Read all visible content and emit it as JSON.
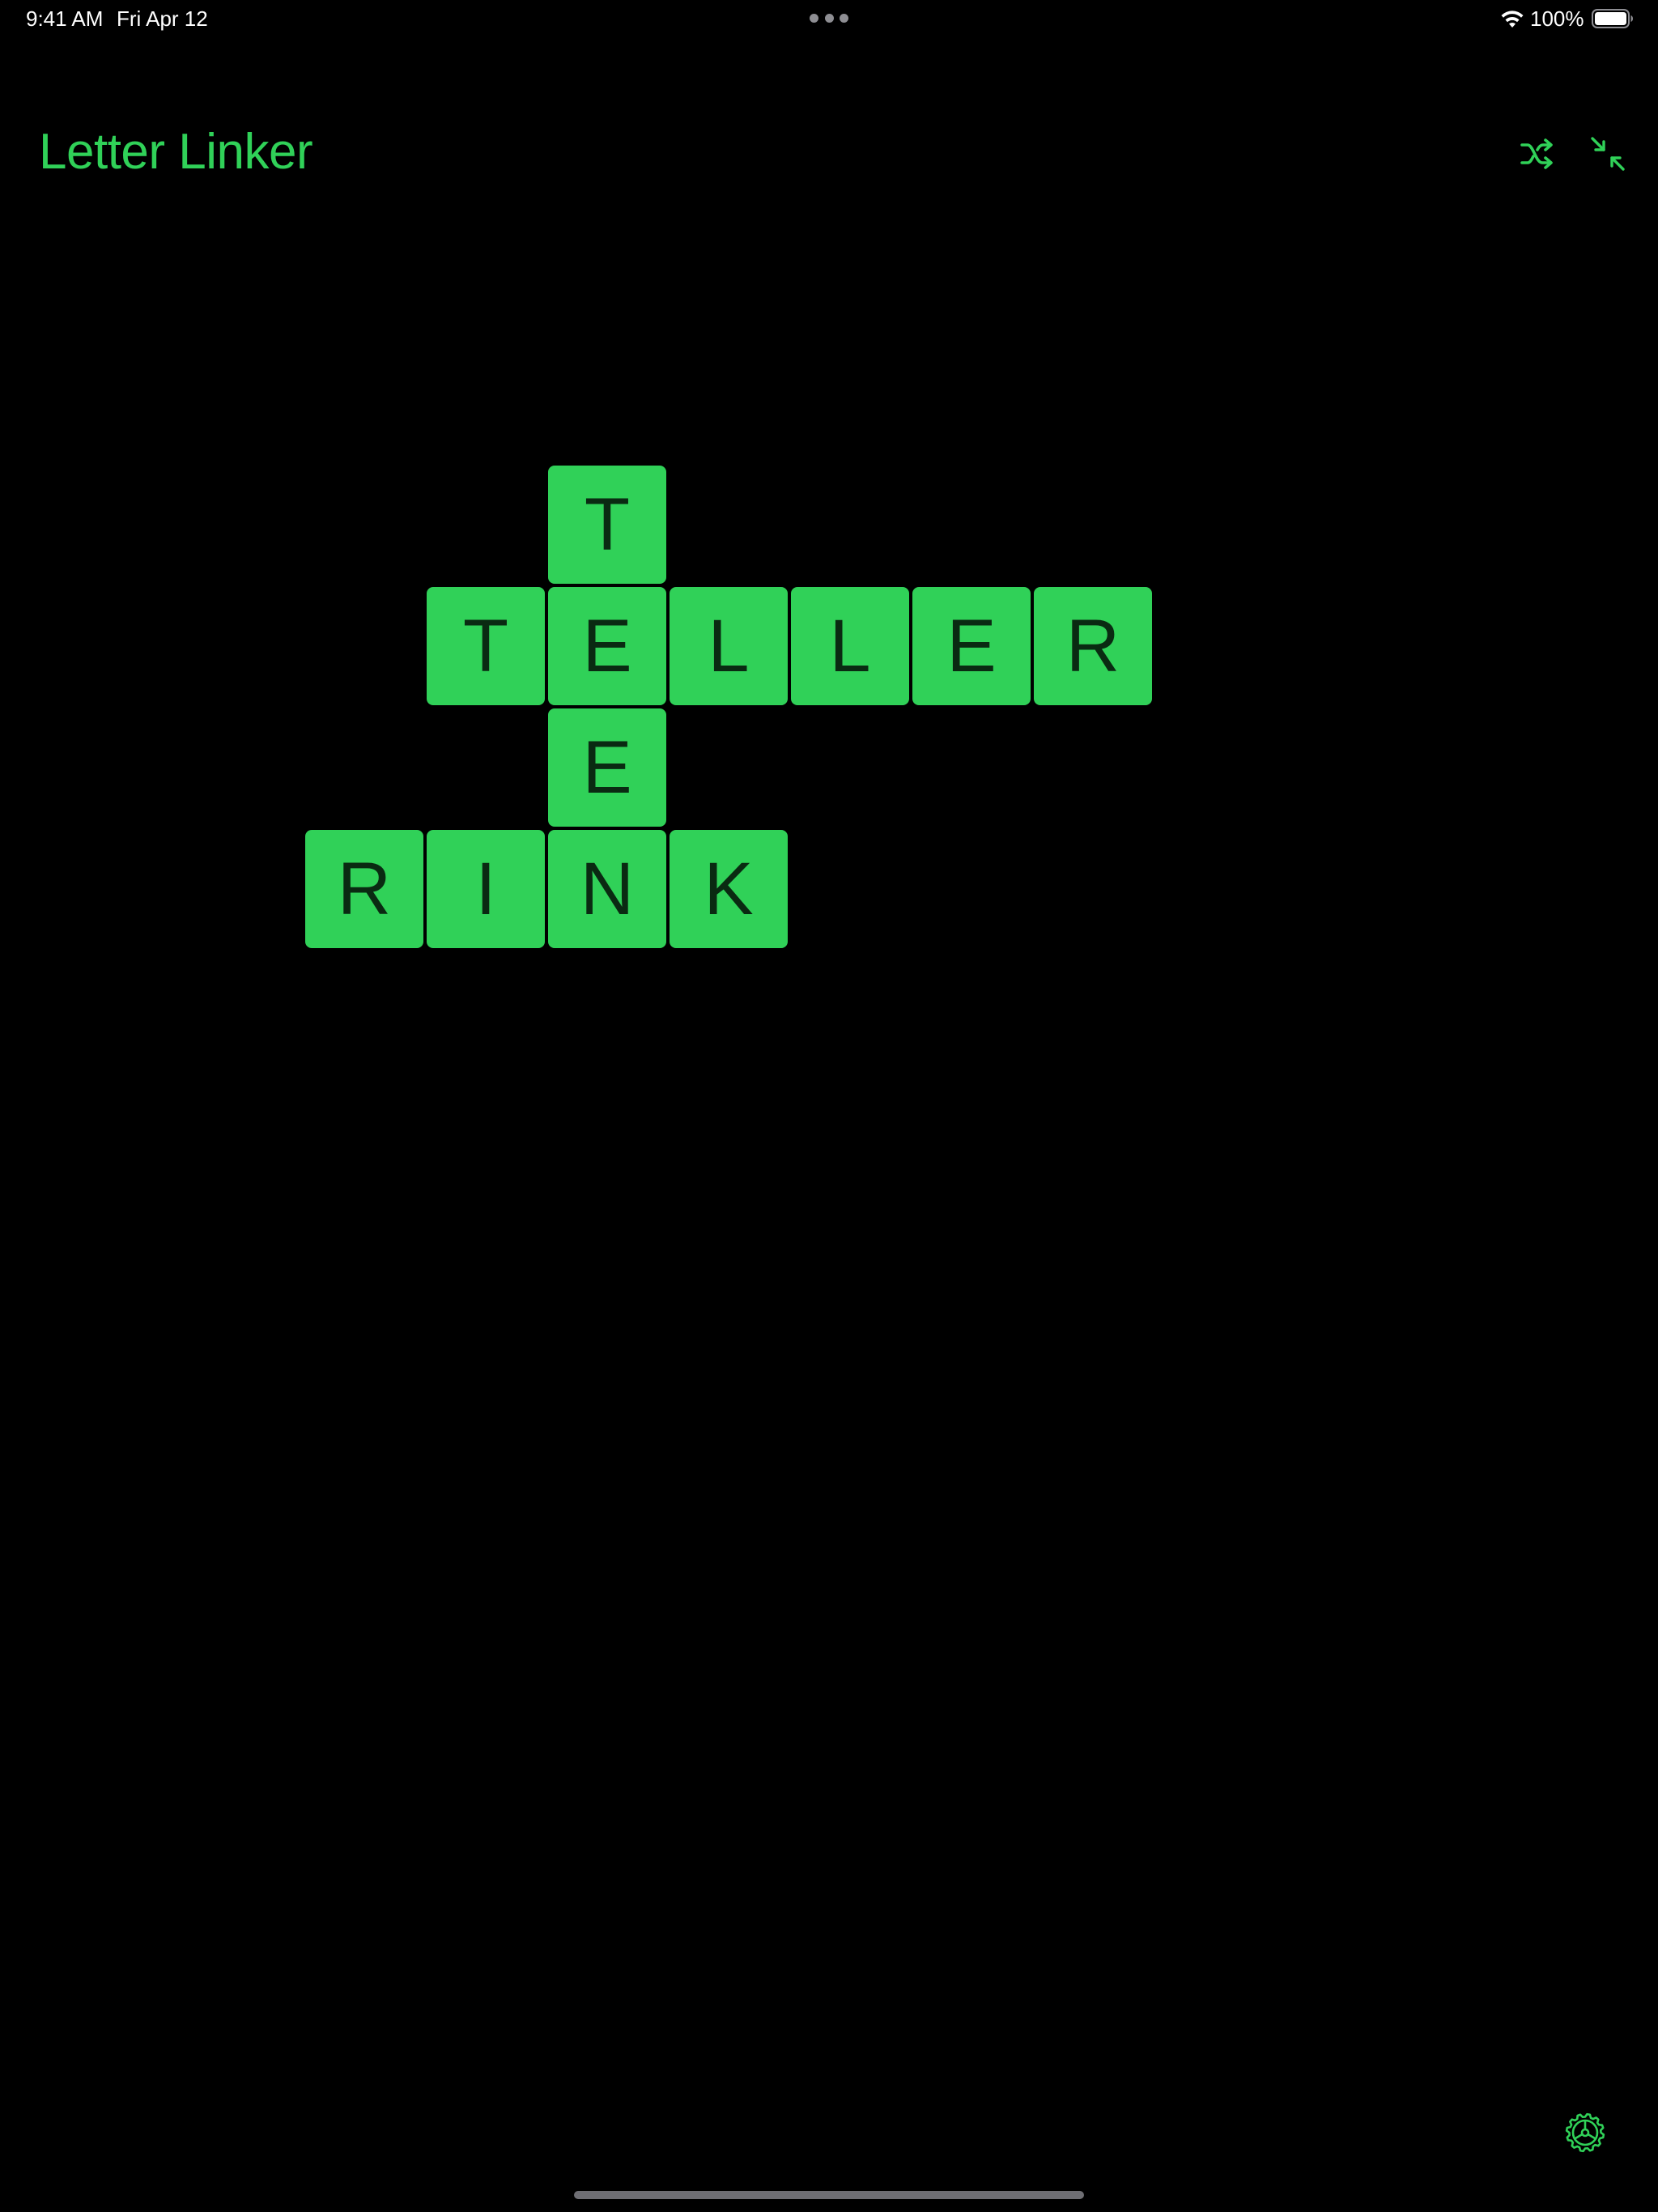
{
  "status_bar": {
    "time": "9:41 AM",
    "date": "Fri Apr 12",
    "battery": "100%"
  },
  "header": {
    "title": "Letter Linker",
    "shuffle_icon": "shuffle-icon",
    "collapse_icon": "arrows-collapse-icon"
  },
  "colors": {
    "accent": "#30d158",
    "background": "#000000",
    "tile_text": "#0a2a12"
  },
  "board": {
    "words": [
      "TELLER",
      "TEE",
      "RINK"
    ],
    "rows": [
      [
        "",
        "",
        "T",
        "",
        "",
        "",
        ""
      ],
      [
        "",
        "T",
        "E",
        "L",
        "L",
        "E",
        "R"
      ],
      [
        "",
        "",
        "E",
        "",
        "",
        "",
        ""
      ],
      [
        "R",
        "I",
        "N",
        "K",
        "",
        "",
        ""
      ]
    ]
  },
  "footer": {
    "settings_icon": "gear-icon"
  }
}
